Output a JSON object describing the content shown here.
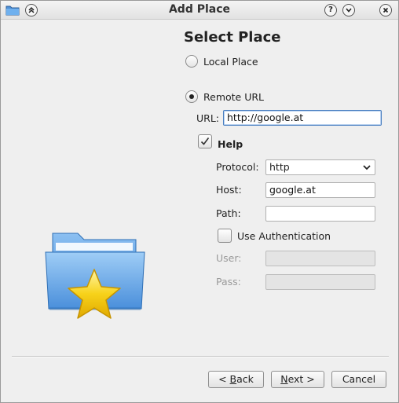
{
  "window": {
    "title": "Add Place"
  },
  "page": {
    "heading": "Select Place"
  },
  "local_place": {
    "label": "Local Place",
    "selected": false
  },
  "remote_url": {
    "label": "Remote URL",
    "selected": true
  },
  "url_field": {
    "label": "URL:",
    "value": "http://google.at"
  },
  "help": {
    "label": "Help",
    "checked": true
  },
  "protocol": {
    "label": "Protocol:",
    "value": "http"
  },
  "host": {
    "label": "Host:",
    "value": "google.at"
  },
  "path": {
    "label": "Path:",
    "value": ""
  },
  "auth": {
    "label": "Use Authentication",
    "checked": false
  },
  "user": {
    "label": "User:",
    "value": ""
  },
  "pass": {
    "label": "Pass:",
    "value": ""
  },
  "buttons": {
    "back_prefix": "< ",
    "back_key": "B",
    "back_rest": "ack",
    "next_key": "N",
    "next_rest": "ext >",
    "cancel": "Cancel"
  },
  "colors": {
    "accent": "#4a7fc1",
    "folder": "#6aa7e6",
    "star": "#f7d21a"
  }
}
